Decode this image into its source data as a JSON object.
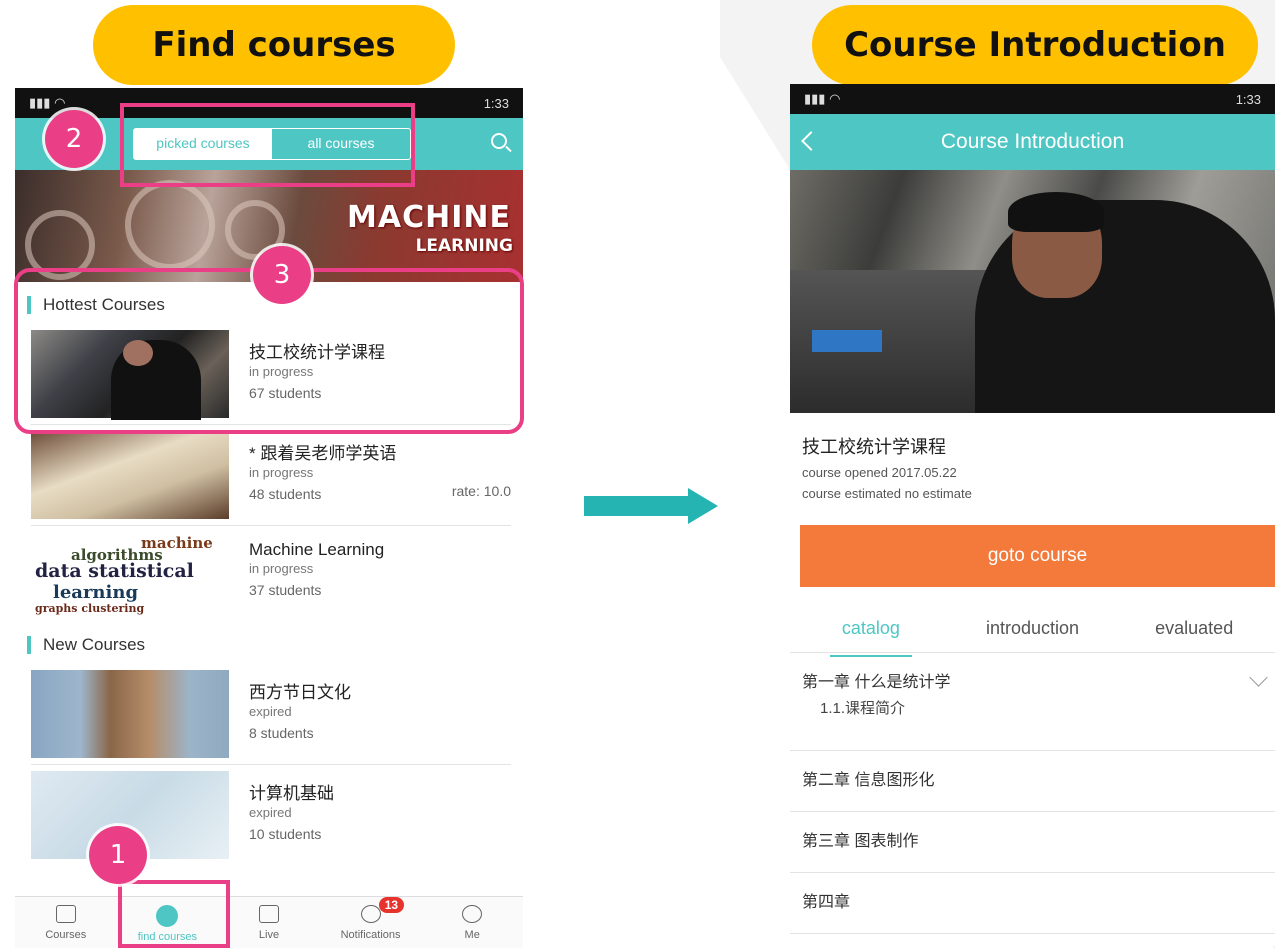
{
  "labels": {
    "left": "Find courses",
    "right": "Course Introduction"
  },
  "left_phone": {
    "status_time": "1:33",
    "segment": {
      "picked": "picked courses",
      "all": "all courses"
    },
    "banner": {
      "title_line1": "MACHINE",
      "title_line2": "LEARNING"
    },
    "hottest_title": "Hottest Courses",
    "hottest": [
      {
        "name": "技工校统计学课程",
        "status": "in progress",
        "students": "67 students",
        "rate": ""
      },
      {
        "name": "* 跟着吴老师学英语",
        "status": "in progress",
        "students": "48 students",
        "rate": "rate: 10.0"
      },
      {
        "name": "Machine Learning",
        "status": "in progress",
        "students": "37 students",
        "rate": ""
      }
    ],
    "new_title": "New Courses",
    "new_courses": [
      {
        "name": "西方节日文化",
        "status": "expired",
        "students": "8 students"
      },
      {
        "name": "计算机基础",
        "status": "expired",
        "students": "10 students"
      }
    ],
    "wordcloud": [
      "machine",
      "algorithms",
      "data statistical",
      "learning",
      "graphs clustering"
    ],
    "tabbar": [
      {
        "label": "Courses",
        "icon": "book-icon"
      },
      {
        "label": "find courses",
        "icon": "compass-icon"
      },
      {
        "label": "Live",
        "icon": "play-icon"
      },
      {
        "label": "Notifications",
        "icon": "bell-icon",
        "badge": "13"
      },
      {
        "label": "Me",
        "icon": "user-icon"
      }
    ]
  },
  "annotations": [
    "1",
    "2",
    "3"
  ],
  "right_phone": {
    "status_time": "1:33",
    "header_title": "Course Introduction",
    "course_name": "技工校统计学课程",
    "opened": "course opened  2017.05.22",
    "estimated": "course estimated  no estimate",
    "goto_label": "goto course",
    "tabs": [
      "catalog",
      "introduction",
      "evaluated"
    ],
    "chapters": [
      {
        "title": "第一章 什么是统计学",
        "sub": "1.1.课程简介"
      },
      {
        "title": "第二章 信息图形化"
      },
      {
        "title": "第三章 图表制作"
      },
      {
        "title": "第四章"
      }
    ]
  },
  "colors": {
    "teal": "#4ec6c3",
    "highlight": "#ea3f86",
    "label_bg": "#ffc000",
    "goto": "#f37a3a"
  }
}
